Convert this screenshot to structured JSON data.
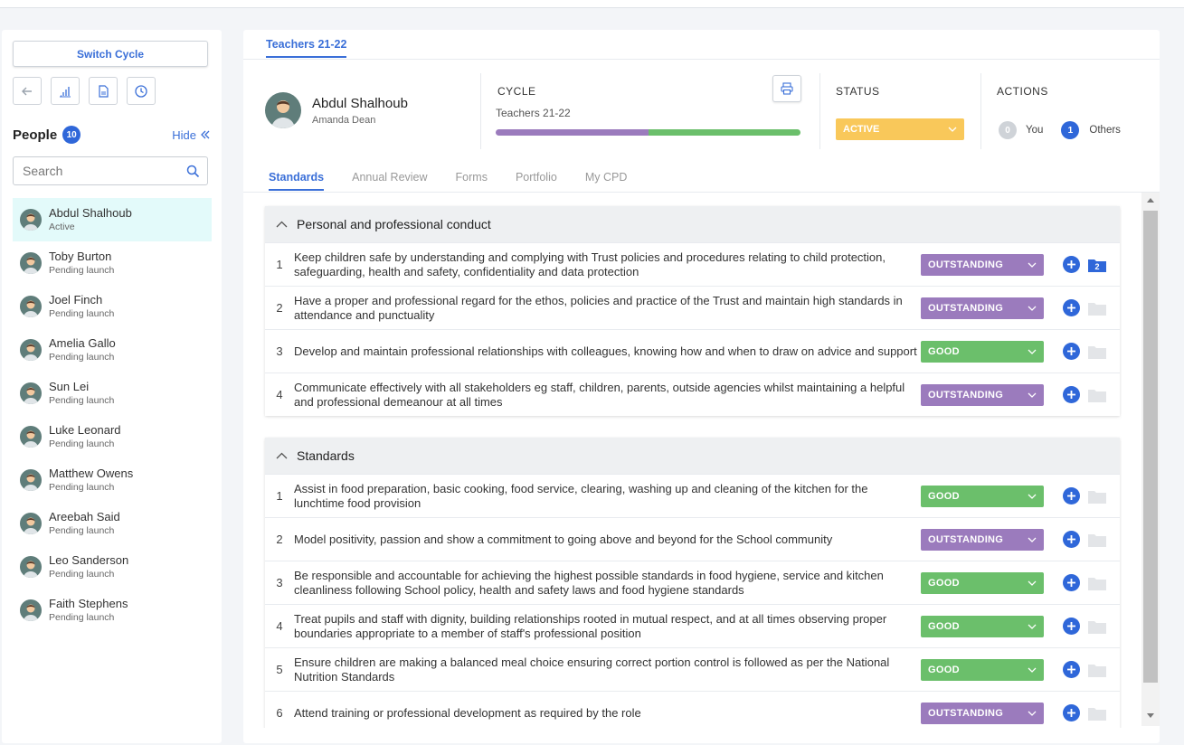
{
  "sidebar": {
    "switch_label": "Switch Cycle",
    "tools": [
      {
        "icon": "back-arrow-icon"
      },
      {
        "icon": "bar-chart-icon"
      },
      {
        "icon": "document-icon"
      },
      {
        "icon": "clock-icon"
      }
    ],
    "people_label": "People",
    "people_count": "10",
    "hide_label": "Hide",
    "search_placeholder": "Search",
    "people": [
      {
        "name": "Abdul Shalhoub",
        "status": "Active",
        "active": true
      },
      {
        "name": "Toby Burton",
        "status": "Pending launch"
      },
      {
        "name": "Joel Finch",
        "status": "Pending launch"
      },
      {
        "name": "Amelia Gallo",
        "status": "Pending launch"
      },
      {
        "name": "Sun Lei",
        "status": "Pending launch"
      },
      {
        "name": "Luke Leonard",
        "status": "Pending launch"
      },
      {
        "name": "Matthew Owens",
        "status": "Pending launch"
      },
      {
        "name": "Areebah Said",
        "status": "Pending launch"
      },
      {
        "name": "Leo Sanderson",
        "status": "Pending launch"
      },
      {
        "name": "Faith Stephens",
        "status": "Pending launch"
      }
    ]
  },
  "header": {
    "cycle_tab": "Teachers 21-22",
    "profile_name": "Abdul Shalhoub",
    "profile_sub": "Amanda Dean",
    "cycle_label": "CYCLE",
    "cycle_name": "Teachers 21-22",
    "cycle_progress": 0.5,
    "status_label": "STATUS",
    "status_value": "ACTIVE",
    "actions_label": "ACTIONS",
    "you_count": "0",
    "you_label": "You",
    "others_count": "1",
    "others_label": "Others"
  },
  "tabs": [
    "Standards",
    "Annual Review",
    "Forms",
    "Portfolio",
    "My CPD"
  ],
  "colors": {
    "accent": "#3a6fd8",
    "outstanding": "#9b7bbd",
    "good": "#6bbf6b",
    "status_active": "#f9c85a"
  },
  "groups": [
    {
      "title": "Personal and professional conduct",
      "rows": [
        {
          "num": "1",
          "text": "Keep children safe by understanding and complying with Trust policies and procedures relating to child protection, safeguarding, health and safety, confidentiality and data protection",
          "rating": "OUTSTANDING",
          "folder_count": "2"
        },
        {
          "num": "2",
          "text": "Have a proper and professional regard for the ethos, policies and practice of the Trust and maintain high standards in attendance and punctuality",
          "rating": "OUTSTANDING"
        },
        {
          "num": "3",
          "text": "Develop and maintain professional relationships with colleagues, knowing how and when to draw on advice and support",
          "rating": "GOOD"
        },
        {
          "num": "4",
          "text": "Communicate effectively with all stakeholders eg staff, children, parents, outside agencies whilst maintaining a helpful and professional demeanour at all times",
          "rating": "OUTSTANDING"
        }
      ]
    },
    {
      "title": "Standards",
      "rows": [
        {
          "num": "1",
          "text": "Assist in food preparation, basic cooking, food service, clearing, washing up and cleaning of the kitchen for the lunchtime food provision",
          "rating": "GOOD"
        },
        {
          "num": "2",
          "text": "Model positivity, passion and show a commitment to going above and beyond for the School community",
          "rating": "OUTSTANDING"
        },
        {
          "num": "3",
          "text": "Be responsible and accountable for achieving the highest possible standards in food hygiene, service and kitchen cleanliness following School policy, health and safety laws and food hygiene standards",
          "rating": "GOOD"
        },
        {
          "num": "4",
          "text": "Treat pupils and staff with dignity, building relationships rooted in mutual respect, and at all times observing proper boundaries appropriate to a member of staff's professional position",
          "rating": "GOOD"
        },
        {
          "num": "5",
          "text": "Ensure children are making a balanced meal choice ensuring correct portion control is followed as per the National Nutrition Standards",
          "rating": "GOOD"
        },
        {
          "num": "6",
          "text": "Attend training or professional development as required by the role",
          "rating": "OUTSTANDING"
        }
      ]
    }
  ]
}
